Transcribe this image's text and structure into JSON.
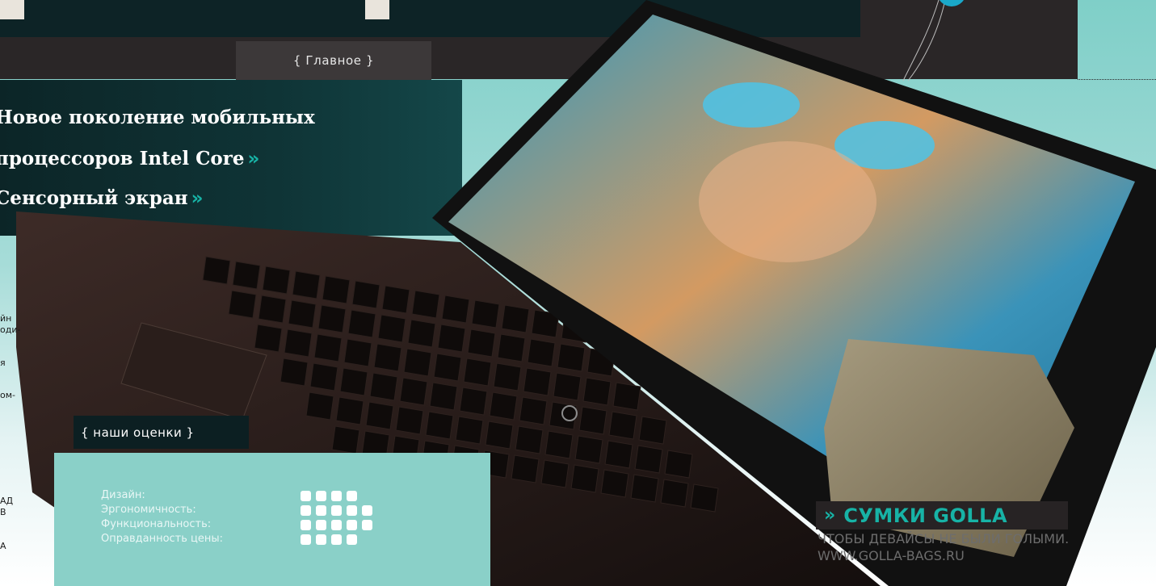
{
  "section_tag": "{ Главное }",
  "headline": {
    "lines": [
      {
        "text": "Новое поколение мобильных",
        "chevron": ""
      },
      {
        "text": "процессоров Intel Core",
        "chevron": "»"
      },
      {
        "text": "Сенсорный экран",
        "chevron": "»"
      }
    ]
  },
  "left_fragments": [
    "йн",
    "оди-",
    "я",
    "ом-",
    "АД",
    "В",
    "А"
  ],
  "ratings": {
    "tab_label": "{ наши оценки }",
    "items": [
      {
        "label": "Дизайн:",
        "score": 4
      },
      {
        "label": "Эргономичность:",
        "score": 5
      },
      {
        "label": "Функциональность:",
        "score": 5
      },
      {
        "label": "Оправданность цены:",
        "score": 4
      }
    ]
  },
  "ad": {
    "arrow": "»",
    "title": "СУМКИ GOLLA",
    "tagline": "ЧТОБЫ ДЕВАЙСЫ НЕ БЫЛИ ГОЛЫМИ.",
    "url": "WWW.GOLLA-BAGS.RU"
  },
  "colors": {
    "accent": "#17b3a6",
    "dark": "#0c2527",
    "panel": "#8ad0c8"
  }
}
